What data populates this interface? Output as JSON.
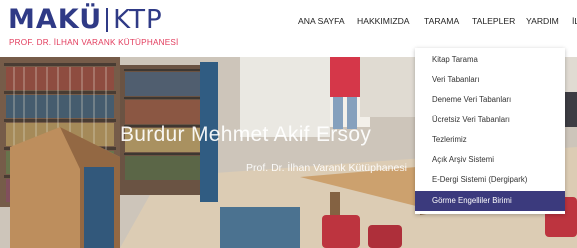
{
  "logo": {
    "brand": "MAKÜ",
    "short": "KTP",
    "subtitle": "PROF. DR. İLHAN VARANK KÜTÜPHANESİ"
  },
  "nav": {
    "items": [
      "ANA SAYFA",
      "HAKKIMIZDA",
      "TARAMA",
      "TALEPLER",
      "YARDIM",
      "İL"
    ]
  },
  "hero": {
    "title": "Burdur Mehmet Akif Ersoy",
    "subtitle": "Prof. Dr. İlhan Varank Kütüphanesi"
  },
  "dropdown": {
    "items": [
      "Kitap Tarama",
      "Veri Tabanları",
      "Deneme Veri Tabanları",
      "Ücretsiz Veri Tabanları",
      "Tezlerimiz",
      "Açık Arşiv Sistemi",
      "E-Dergi Sistemi (Dergipark)",
      "Görme Engelliler Birimi"
    ],
    "active_index": 7
  },
  "colors": {
    "brand_blue": "#2f3a86",
    "brand_red": "#e23c5d",
    "active_menu": "#3b3a7d"
  }
}
